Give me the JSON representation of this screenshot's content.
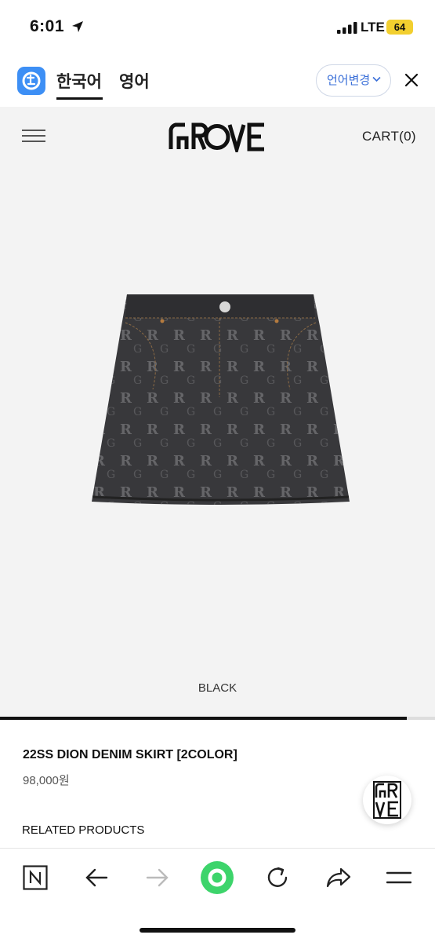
{
  "status_bar": {
    "time": "6:01",
    "network": "LTE",
    "battery": "64",
    "battery_color": "#f2cf2f"
  },
  "translator": {
    "tabs": [
      {
        "label": "한국어",
        "active": true
      },
      {
        "label": "영어",
        "active": false
      }
    ],
    "language_button": "언어변경",
    "accent_color": "#3a6fd8"
  },
  "site_header": {
    "logo": "GROVE",
    "cart_label": "CART(0)"
  },
  "gallery": {
    "color_label": "BLACK",
    "progress_fraction": 0.935
  },
  "product": {
    "name": "22SS DION DENIM SKIRT [2COLOR]",
    "price": "98,000원"
  },
  "related_heading": "RELATED PRODUCTS",
  "badge": {
    "monogram": "GR VE"
  },
  "toolbar": {
    "icons": [
      "naver-n-icon",
      "back-arrow-icon",
      "forward-arrow-icon",
      "green-dot-icon",
      "reload-icon",
      "share-icon",
      "menu-icon"
    ],
    "green_color": "#3dd46b"
  }
}
